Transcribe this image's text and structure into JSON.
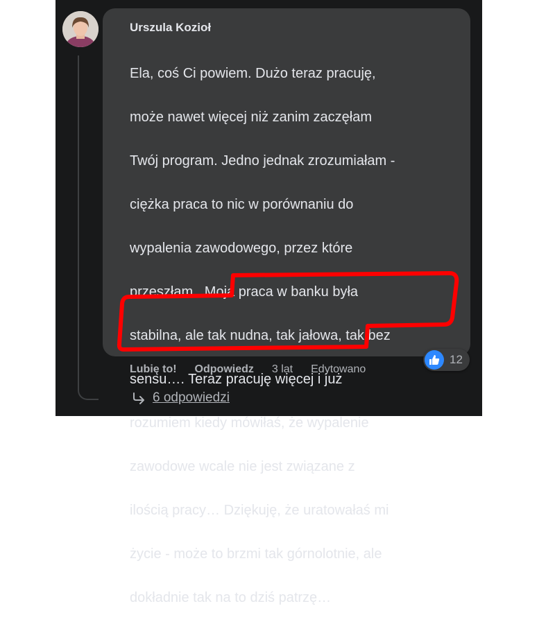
{
  "comment": {
    "author": "Urszula Kozioł",
    "text_lines": [
      "Ela, coś Ci powiem. Dużo teraz pracuję,",
      "może nawet więcej niż zanim zaczęłam",
      "Twój program. Jedno jednak zrozumiałam -",
      "ciężka praca to nic w porównaniu do",
      "wypalenia zawodowego, przez które",
      "przeszłam . Moja praca w banku była",
      "stabilna, ale tak nudna, tak jałowa, tak bez",
      "sensu…. Teraz pracuję więcej i już",
      "rozumiem kiedy mówiłaś, że wypalenie",
      "zawodowe wcale nie jest związane z",
      "ilością pracy… Dziękuję, że uratowałaś mi",
      "życie - może to brzmi tak górnolotnie, ale",
      "dokładnie tak na to dziś patrzę…"
    ],
    "reaction_icon": "thumbs-up-icon",
    "reaction_count": "12",
    "actions": {
      "like": "Lubię to!",
      "reply": "Odpowiedz",
      "time": "3 lat",
      "edited": "Edytowano"
    },
    "replies_label": "6 odpowiedzi",
    "replies_icon": "reply-arrow-icon"
  },
  "colors": {
    "background": "#18191a",
    "bubble": "#3a3b3c",
    "text": "#e4e6eb",
    "secondary_text": "#b0b3b8",
    "like_blue": "#2d88ff",
    "highlight_red": "#ff0000"
  }
}
